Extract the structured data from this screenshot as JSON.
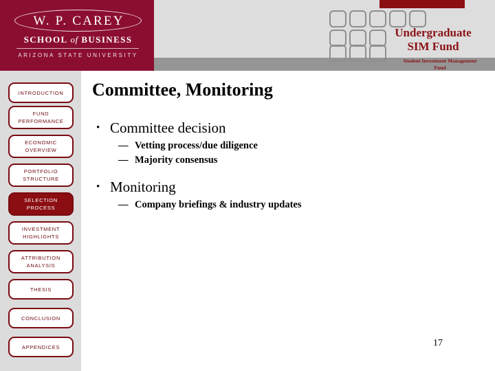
{
  "slide": {
    "page_number": "17",
    "accent_maroon": "#8b0e30",
    "accent_red": "#8a1216",
    "band_light": "#dddddd",
    "band_dark": "#959595",
    "sidebar_bg": "#dcdcdc"
  },
  "logo": {
    "name": "W. P. CAREY",
    "school_prefix": "SCHOOL",
    "school_of": "of",
    "school_suffix": "BUSINESS",
    "university": "ARIZONA STATE UNIVERSITY"
  },
  "header": {
    "title_line1": "Undergraduate",
    "title_line2": "SIM Fund",
    "subtitle_line1": "Student Investment Management",
    "subtitle_line2": "Fund",
    "squares_row1": 5,
    "squares_row2": 3,
    "squares_row3": 3
  },
  "sidebar": {
    "items": [
      {
        "label": "INTRODUCTION",
        "selected": false
      },
      {
        "label": "FUND\nPERFORMANCE",
        "selected": false
      },
      {
        "label": "ECONOMIC\nOVERVIEW",
        "selected": false
      },
      {
        "label": "PORTFOLIO\nSTRUCTURE",
        "selected": false
      },
      {
        "label": "SELECTION\nPROCESS",
        "selected": true
      },
      {
        "label": "INVESTMENT\nHIGHLIGHTS",
        "selected": false
      },
      {
        "label": "ATTRIBUTION\nANALYSIS",
        "selected": false
      },
      {
        "label": "THESIS",
        "selected": false
      },
      {
        "label": "CONCLUSION",
        "selected": false
      },
      {
        "label": "APPENDICES",
        "selected": false
      }
    ]
  },
  "main": {
    "title": "Committee, Monitoring",
    "bullet_marker": "•",
    "dash_marker": "—",
    "groups": [
      {
        "heading": "Committee decision",
        "subpoints": [
          "Vetting process/due diligence",
          "Majority consensus"
        ]
      },
      {
        "heading": "Monitoring",
        "subpoints": [
          "Company briefings & industry updates"
        ]
      }
    ]
  }
}
